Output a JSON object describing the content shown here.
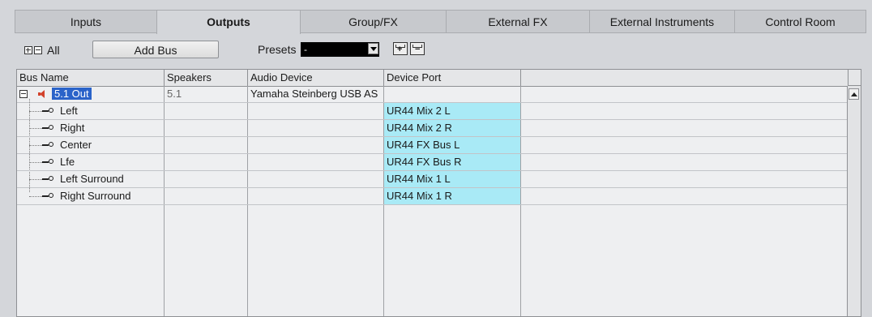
{
  "tabs": [
    "Inputs",
    "Outputs",
    "Group/FX",
    "External FX",
    "External Instruments",
    "Control Room"
  ],
  "active_tab": "Outputs",
  "toolbar": {
    "all_label": "All",
    "add_bus_label": "Add Bus",
    "presets_label": "Presets",
    "preset_value": "-"
  },
  "columns": [
    "Bus Name",
    "Speakers",
    "Audio Device",
    "Device Port"
  ],
  "bus": {
    "name": "5.1 Out",
    "speakers": "5.1",
    "audio_device": "Yamaha Steinberg USB AS"
  },
  "channels": [
    {
      "name": "Left",
      "port": "UR44 Mix 2 L"
    },
    {
      "name": "Right",
      "port": "UR44 Mix 2 R"
    },
    {
      "name": "Center",
      "port": "UR44 FX Bus L"
    },
    {
      "name": "Lfe",
      "port": "UR44 FX Bus R"
    },
    {
      "name": "Left Surround",
      "port": "UR44 Mix 1 L"
    },
    {
      "name": "Right Surround",
      "port": "UR44 Mix 1 R"
    }
  ],
  "colors": {
    "port_highlight": "#a9eaf6",
    "selection": "#2a63c9",
    "speaker_icon": "#d2422b"
  }
}
